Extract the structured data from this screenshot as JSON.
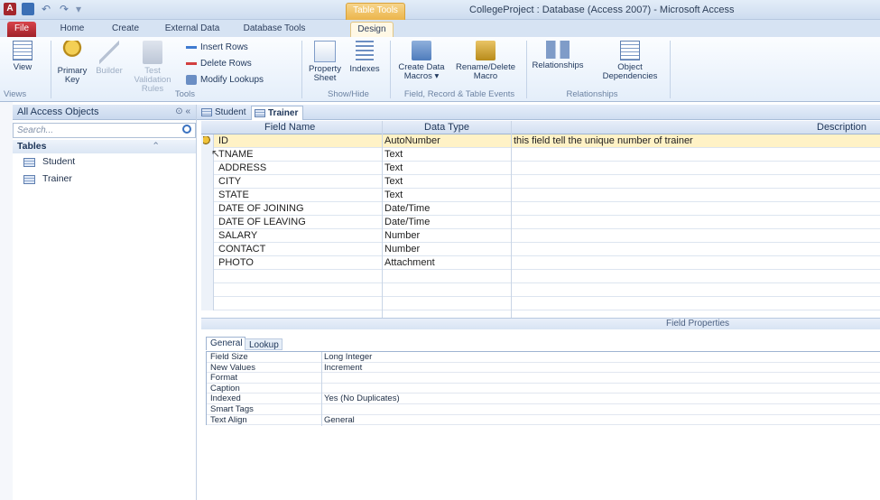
{
  "window": {
    "title": "CollegeProject : Database (Access 2007)  -  Microsoft Access",
    "context_tab": "Table Tools"
  },
  "qat": {
    "app_icon_letter": "A"
  },
  "ribbon_tabs": [
    "File",
    "Home",
    "Create",
    "External Data",
    "Database Tools",
    "Design"
  ],
  "ribbon": {
    "views": {
      "view_label": "View",
      "group_label": "Views"
    },
    "tools": {
      "primary_key": "Primary Key",
      "builder": "Builder",
      "test_validation": "Test Validation Rules",
      "insert_rows": "Insert Rows",
      "delete_rows": "Delete Rows",
      "modify_lookups": "Modify Lookups",
      "group_label": "Tools"
    },
    "show_hide": {
      "property_sheet": "Property Sheet",
      "indexes": "Indexes",
      "group_label": "Show/Hide"
    },
    "events": {
      "create_data_macros": "Create Data Macros ▾",
      "rename_delete_macro": "Rename/Delete Macro",
      "group_label": "Field, Record & Table Events"
    },
    "relationships": {
      "relationships": "Relationships",
      "object_dependencies": "Object Dependencies",
      "group_label": "Relationships"
    }
  },
  "nav": {
    "header": "All Access Objects",
    "search_placeholder": "Search...",
    "group": "Tables",
    "items": [
      "Student",
      "Trainer"
    ]
  },
  "doc_tabs": [
    "Student",
    "Trainer"
  ],
  "grid": {
    "headers": {
      "field_name": "Field Name",
      "data_type": "Data Type",
      "description": "Description"
    },
    "rows": [
      {
        "field": "ID",
        "type": "AutoNumber",
        "desc": "this field tell the unique number of trainer"
      },
      {
        "field": "TNAME",
        "type": "Text",
        "desc": ""
      },
      {
        "field": "ADDRESS",
        "type": "Text",
        "desc": ""
      },
      {
        "field": "CITY",
        "type": "Text",
        "desc": ""
      },
      {
        "field": "STATE",
        "type": "Text",
        "desc": ""
      },
      {
        "field": "DATE OF JOINING",
        "type": "Date/Time",
        "desc": ""
      },
      {
        "field": "DATE OF LEAVING",
        "type": "Date/Time",
        "desc": ""
      },
      {
        "field": "SALARY",
        "type": "Number",
        "desc": ""
      },
      {
        "field": "CONTACT",
        "type": "Number",
        "desc": ""
      },
      {
        "field": "PHOTO",
        "type": "Attachment",
        "desc": ""
      }
    ]
  },
  "field_properties": {
    "title": "Field Properties",
    "tabs": [
      "General",
      "Lookup"
    ],
    "rows": [
      {
        "prop": "Field Size",
        "value": "Long Integer"
      },
      {
        "prop": "New Values",
        "value": "Increment"
      },
      {
        "prop": "Format",
        "value": ""
      },
      {
        "prop": "Caption",
        "value": ""
      },
      {
        "prop": "Indexed",
        "value": "Yes (No Duplicates)"
      },
      {
        "prop": "Smart Tags",
        "value": ""
      },
      {
        "prop": "Text Align",
        "value": "General"
      }
    ]
  },
  "colors": {
    "accent": "#2b579a",
    "file_tab": "#a4262c",
    "context_tab": "#ecb54b",
    "selected_row": "#fff2c6"
  }
}
